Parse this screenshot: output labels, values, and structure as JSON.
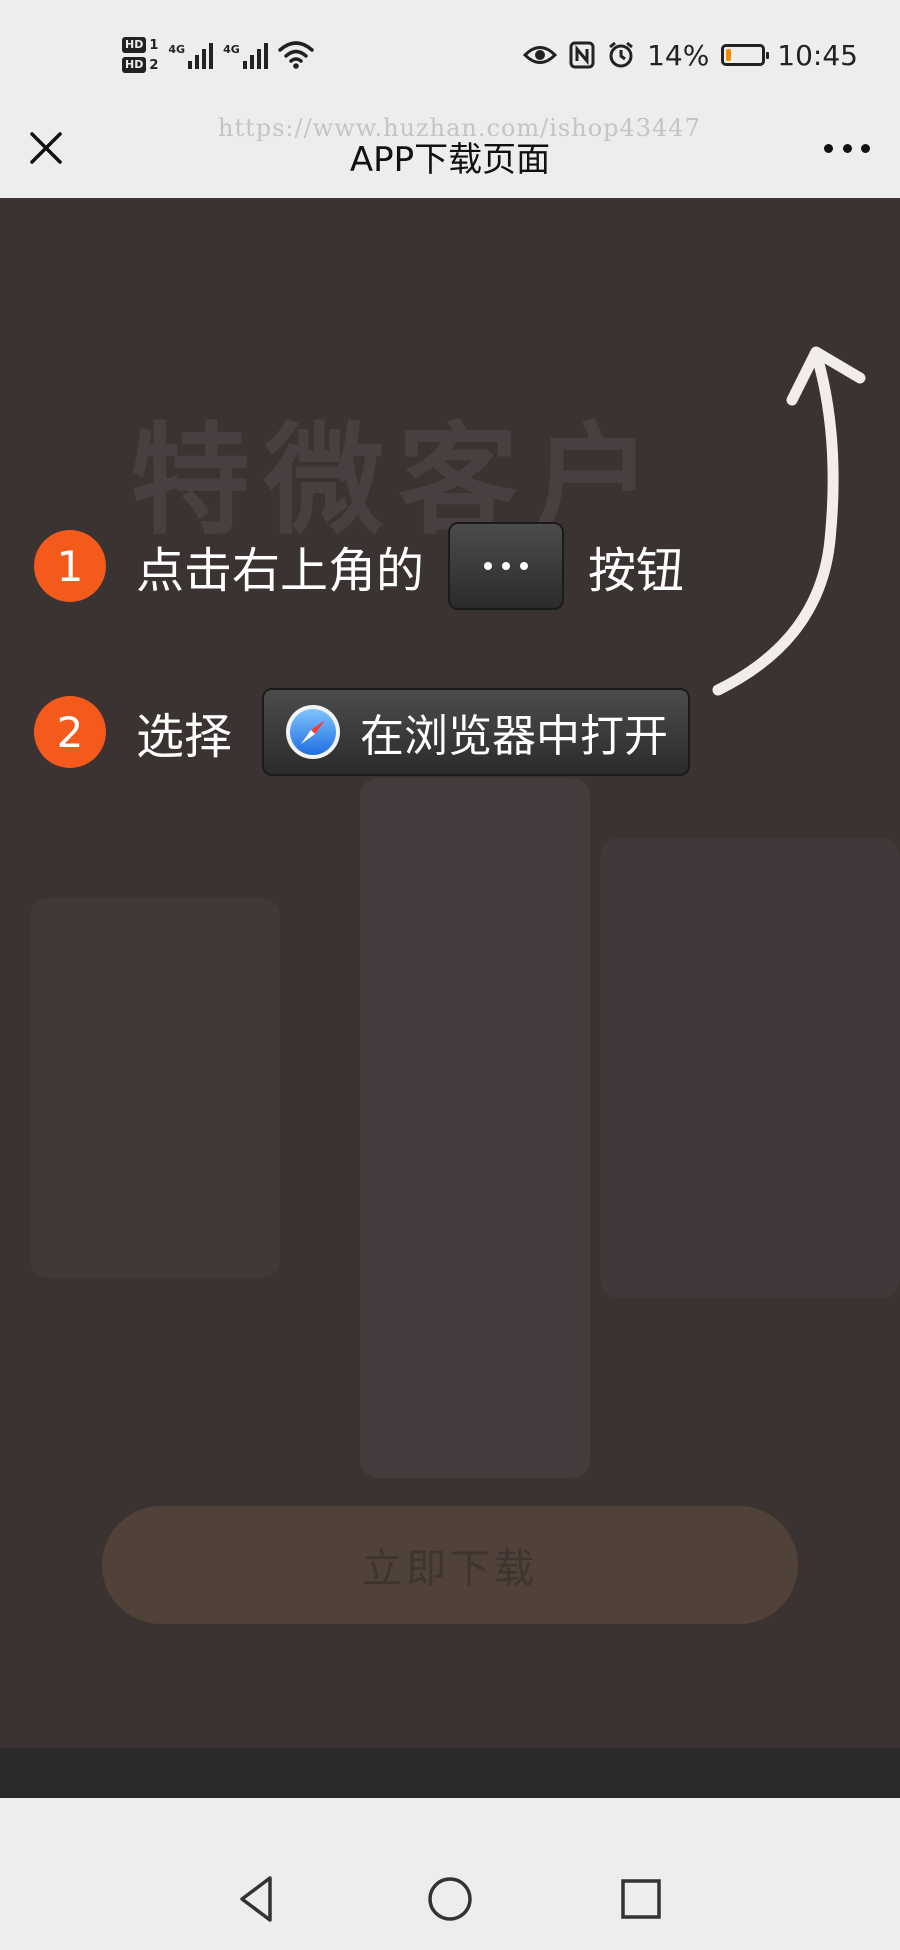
{
  "status_bar": {
    "hd1": "HD",
    "hd1_num": "1",
    "hd2": "HD",
    "hd2_num": "2",
    "signal1_label": "4G",
    "signal2_label": "4G",
    "battery_percent": "14%",
    "battery_level": 0.14,
    "time": "10:45",
    "icons": [
      "wifi-icon",
      "eye-icon",
      "nfc-icon",
      "alarm-icon",
      "battery-icon"
    ]
  },
  "title_bar": {
    "title": "APP下载页面",
    "watermark": "https://www.huzhan.com/ishop43447",
    "close_icon": "close-icon",
    "more_icon": "more-icon"
  },
  "overlay": {
    "background_heading": "特微客户",
    "background_button": "立即下载",
    "steps": [
      {
        "number": "1",
        "text_before": "点击右上角的",
        "text_after": "按钮",
        "button_icon": "more-dots-icon"
      },
      {
        "number": "2",
        "text_before": "选择",
        "button_label": "在浏览器中打开",
        "button_icon": "compass-icon"
      }
    ],
    "colors": {
      "badge": "#f55a1d",
      "overlay": "#3b3232"
    }
  },
  "nav_bar": {
    "icons": [
      "back-triangle-icon",
      "home-circle-icon",
      "recents-square-icon"
    ]
  }
}
